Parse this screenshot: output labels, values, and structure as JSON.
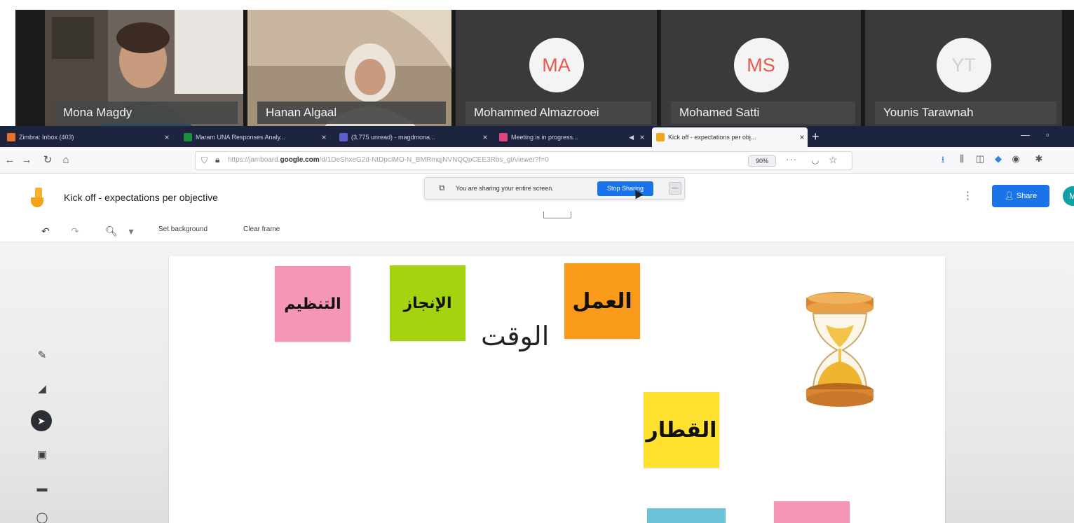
{
  "participants": [
    {
      "name": "Mona Magdy",
      "type": "video"
    },
    {
      "name": "Hanan Algaal",
      "type": "video"
    },
    {
      "name": "Mohammed Almazrooei",
      "type": "avatar",
      "initials": "MA",
      "initials_color": "#e8594c"
    },
    {
      "name": "Mohamed Satti",
      "type": "avatar",
      "initials": "MS",
      "initials_color": "#e8594c"
    },
    {
      "name": "Younis Tarawnah",
      "type": "avatar",
      "initials": "YT",
      "initials_color": "#cfcfcf"
    }
  ],
  "browser": {
    "tabs": [
      {
        "label": "Zimbra: Inbox (403)",
        "icon": "zimbra-icon",
        "icon_color": "#e8702a"
      },
      {
        "label": "Maram UNA Responses Analy...",
        "icon": "sheets-icon",
        "icon_color": "#1e8e3e"
      },
      {
        "label": "(3,775 unread) - magdmona...",
        "icon": "mail-icon",
        "icon_color": "#5b5fc7"
      },
      {
        "label": "Meeting is in progress...",
        "icon": "webex-icon",
        "icon_color": "#e0457b"
      },
      {
        "label": "Kick off - expectations per obj...",
        "icon": "jamboard-icon",
        "icon_color": "#f4a31a",
        "active": true
      }
    ],
    "new_tab_label": "+",
    "url_prefix": "https://jamboard.",
    "url_domain": "google.com",
    "url_path": "/d/1DeShxeG2d-NtDpcIMO-N_BMRmqjNVNQQpCEE3Rbs_gt/viewer?f=0",
    "zoom": "90%",
    "more_label": "···"
  },
  "jamboard": {
    "title": "Kick off - expectations per objective",
    "share_label": "Share",
    "user_initial": "M",
    "toolbar": {
      "set_background": "Set background",
      "clear_frame": "Clear frame"
    },
    "share_notice": {
      "text": "You are sharing your entire screen.",
      "stop_label": "Stop Sharing",
      "hide_label": "Hide"
    }
  },
  "board": {
    "stickies": [
      {
        "text": "التنظيم",
        "color": "#f596b4"
      },
      {
        "text": "الإنجاز",
        "color": "#a4d40f"
      },
      {
        "text": "العمل",
        "color": "#f99a1a"
      },
      {
        "text": "القطار",
        "color": "#fde12e"
      },
      {
        "text": "",
        "color": "#6cc3d8"
      },
      {
        "text": "",
        "color": "#f596b4"
      }
    ],
    "free_text": "الوقت"
  },
  "colors": {
    "accent": "#1a73e8",
    "tabbar": "#1d2440"
  }
}
